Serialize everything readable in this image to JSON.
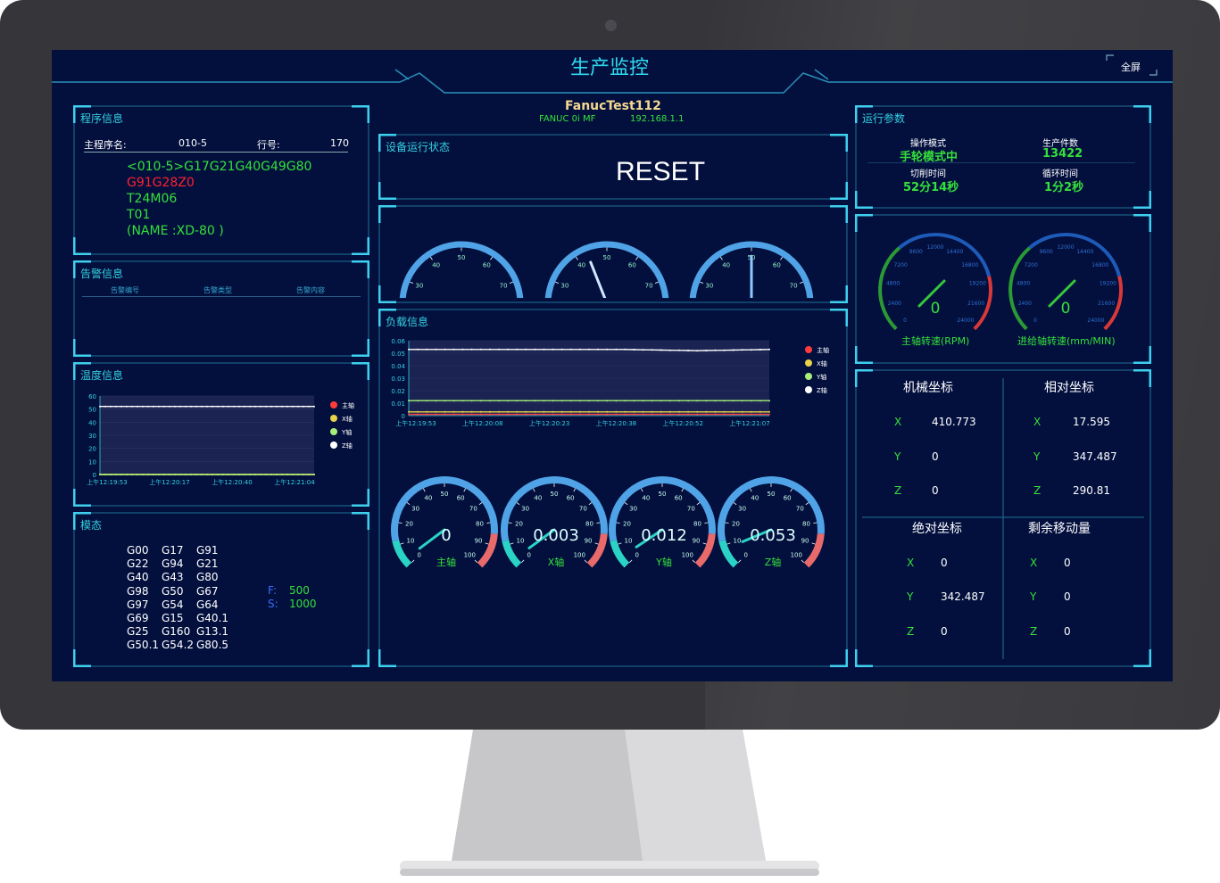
{
  "header": {
    "title": "生产监控",
    "fullscreen_label": "全屏"
  },
  "device": {
    "name": "FanucTest112",
    "model": "FANUC 0i MF",
    "ip": "192.168.1.1"
  },
  "program": {
    "title": "程序信息",
    "main_label": "主程序名:",
    "main_value": "010-5",
    "line_label": "行号:",
    "line_value": "170",
    "lines": [
      "<010-5>G17G21G40G49G80",
      "G91G28Z0",
      "T24M06",
      "T01",
      "(NAME :XD-80 )"
    ]
  },
  "alarm": {
    "title": "告警信息",
    "columns": [
      "告警编号",
      "告警类型",
      "告警内容"
    ]
  },
  "temperature": {
    "title": "温度信息"
  },
  "modal": {
    "title": "模态",
    "rows": [
      [
        "G00",
        "G17",
        "G91"
      ],
      [
        "G22",
        "G94",
        "G21"
      ],
      [
        "G40",
        "G43",
        "G80"
      ],
      [
        "G98",
        "G50",
        "G67"
      ],
      [
        "G97",
        "G54",
        "G64"
      ],
      [
        "G69",
        "G15",
        "G40.1"
      ],
      [
        "G25",
        "G160",
        "G13.1"
      ],
      [
        "G50.1",
        "G54.2",
        "G80.5"
      ]
    ],
    "f_label": "F:",
    "f_value": "500",
    "s_label": "S:",
    "s_value": "1000"
  },
  "status": {
    "title": "设备运行状态",
    "value": "RESET"
  },
  "load": {
    "title": "负载信息"
  },
  "run_params": {
    "title": "运行参数",
    "mode_label": "操作模式",
    "mode_value": "手轮模式中",
    "count_label": "生产件数",
    "count_value": "13422",
    "cut_label": "切削时间",
    "cut_value": "52分14秒",
    "cycle_label": "循环时间",
    "cycle_value": "1分2秒"
  },
  "speed": {
    "spindle_label": "主轴转速(RPM)",
    "spindle_value": "0",
    "feed_label": "进给轴转速(mm/MIN)",
    "feed_value": "0"
  },
  "coords": {
    "machine": {
      "title": "机械坐标",
      "x": "410.773",
      "y": "0",
      "z": "0"
    },
    "relative": {
      "title": "相对坐标",
      "x": "17.595",
      "y": "347.487",
      "z": "290.81"
    },
    "absolute": {
      "title": "绝对坐标",
      "x": "0",
      "y": "342.487",
      "z": "0"
    },
    "remaining": {
      "title": "剩余移动量",
      "x": "0",
      "y": "0",
      "z": "0"
    },
    "axis_x": "X",
    "axis_y": "Y",
    "axis_z": "Z"
  },
  "load_gauges": [
    {
      "label": "主轴",
      "value": "0"
    },
    {
      "label": "X轴",
      "value": "0.003"
    },
    {
      "label": "Y轴",
      "value": "0.012"
    },
    {
      "label": "Z轴",
      "value": "0.053"
    }
  ],
  "chart_data": [
    {
      "type": "line",
      "name": "temperature",
      "x": [
        "上午12:19:53",
        "上午12:20:17",
        "上午12:20:40",
        "上午12:21:04"
      ],
      "yticks": [
        "0",
        "10",
        "20",
        "30",
        "40",
        "50",
        "60"
      ],
      "ylim": [
        0,
        60
      ],
      "series": [
        {
          "name": "主轴",
          "color": "#ff3b3b",
          "values": [
            0,
            0,
            0,
            0
          ]
        },
        {
          "name": "X轴",
          "color": "#e8d24a",
          "values": [
            0,
            0,
            0,
            0
          ]
        },
        {
          "name": "Y轴",
          "color": "#a6f07a",
          "values": [
            0,
            0,
            0,
            0
          ]
        },
        {
          "name": "Z轴",
          "color": "#ffffff",
          "values": [
            52,
            52,
            52,
            52
          ]
        }
      ],
      "legend": "right"
    },
    {
      "type": "line",
      "name": "load",
      "x": [
        "上午12:19:53",
        "上午12:20:08",
        "上午12:20:23",
        "上午12:20:38",
        "上午12:20:52",
        "上午12:21:07"
      ],
      "yticks": [
        "0",
        "0.01",
        "0.02",
        "0.03",
        "0.04",
        "0.05",
        "0.06"
      ],
      "ylim": [
        0,
        0.06
      ],
      "series": [
        {
          "name": "主轴",
          "color": "#ff3b3b",
          "values": [
            0.001,
            0.001,
            0.001,
            0.001,
            0.001,
            0.001
          ]
        },
        {
          "name": "X轴",
          "color": "#e8d24a",
          "values": [
            0.003,
            0.003,
            0.003,
            0.003,
            0.003,
            0.003
          ]
        },
        {
          "name": "Y轴",
          "color": "#a6f07a",
          "values": [
            0.012,
            0.012,
            0.012,
            0.012,
            0.012,
            0.012
          ]
        },
        {
          "name": "Z轴",
          "color": "#ffffff",
          "values": [
            0.053,
            0.053,
            0.053,
            0.053,
            0.052,
            0.053
          ]
        }
      ],
      "legend": "right"
    }
  ]
}
